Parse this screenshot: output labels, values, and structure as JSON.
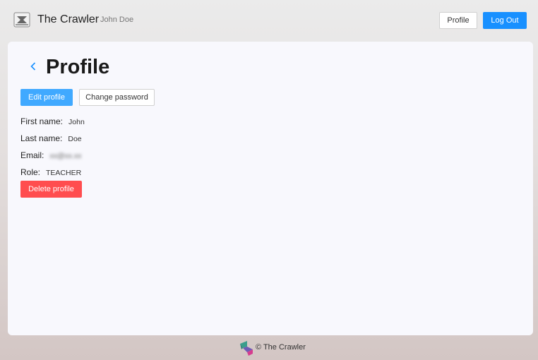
{
  "header": {
    "logo_icon": "school-logo-icon",
    "app_title": "The Crawler",
    "user_name": "John Doe",
    "profile_label": "Profile",
    "logout_label": "Log Out"
  },
  "page": {
    "back_icon": "chevron-left-icon",
    "title": "Profile",
    "edit_profile_label": "Edit profile",
    "change_password_label": "Change password",
    "fields": [
      {
        "label": "First name:",
        "value": "John"
      },
      {
        "label": "Last name:",
        "value": "Doe"
      },
      {
        "label": "Email:",
        "value": "xx@xx.xx"
      },
      {
        "label": "Role:",
        "value": "TEACHER"
      }
    ],
    "delete_label": "Delete profile"
  },
  "footer": {
    "logo_icon": "crawler-logo-icon",
    "text": "© The Crawler"
  },
  "colors": {
    "primary": "#1890ff",
    "danger": "#ff4d4f"
  }
}
